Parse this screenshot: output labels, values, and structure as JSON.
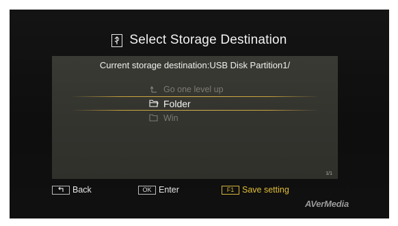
{
  "dialog": {
    "title": "Select Storage Destination",
    "title_icon": "usb-drive-icon",
    "current_destination": "Current storage destination:USB Disk Partition1/"
  },
  "file_list": {
    "items": [
      {
        "icon": "level-up-icon",
        "label": "Go one level up",
        "selected": false
      },
      {
        "icon": "folder-icon",
        "label": "Folder",
        "selected": true
      },
      {
        "icon": "folder-icon",
        "label": "Win",
        "selected": false
      }
    ],
    "page_indicator": "1/1"
  },
  "footer": {
    "back": {
      "key": "⮌",
      "label": "Back"
    },
    "enter": {
      "key": "OK",
      "label": "Enter"
    },
    "save": {
      "key": "F1",
      "label": "Save setting"
    }
  },
  "brand": "AVerMedia",
  "colors": {
    "background": "#101010",
    "panel": "#36362f",
    "accent": "#d7b43a",
    "text": "#f0f0f0",
    "dim_text": "#7c7c74"
  }
}
